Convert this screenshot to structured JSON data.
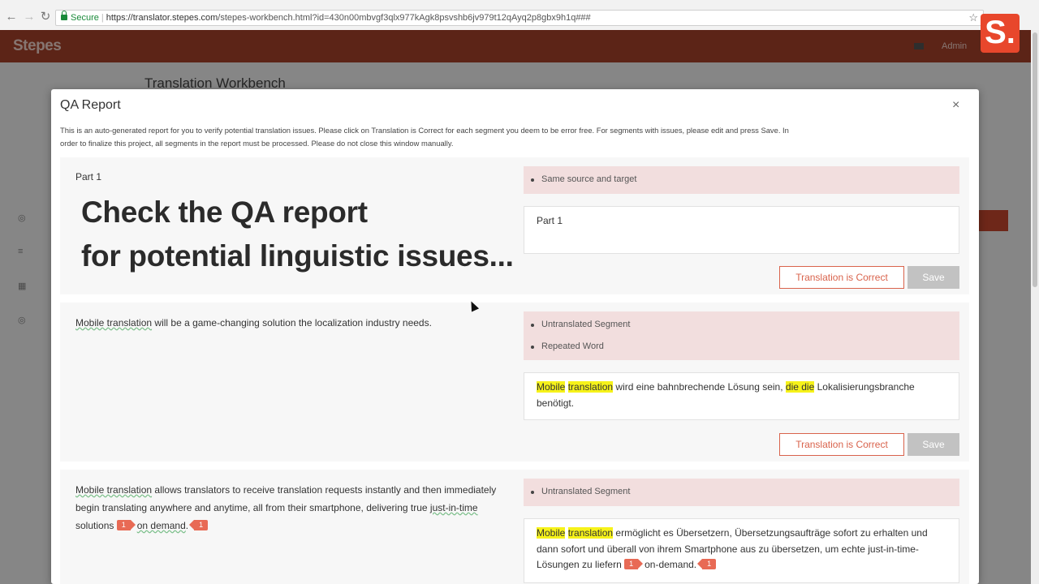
{
  "browser": {
    "secure_label": "Secure",
    "url_host": "https://translator.stepes.com",
    "url_path": "/stepes-workbench.html?id=430n00mbvgf3qlx977kAgk8psvshb6jv979t12qAyq2p8gbx9h1q###"
  },
  "app": {
    "logo": "Stepes",
    "admin_label": "Admin",
    "page_title": "Translation Workbench"
  },
  "brand_badge": "S.",
  "modal": {
    "title": "QA Report",
    "close": "×",
    "description": "This is an auto-generated report for you to verify potential translation issues. Please click on Translation is Correct for each segment you deem to be error free. For segments with issues, please edit and press Save. In order to finalize this project, all segments in the report must be processed. Please do not close this window manually."
  },
  "caption": {
    "line1": "Check the QA report",
    "line2": "for potential linguistic issues..."
  },
  "segments": [
    {
      "source": "Part 1",
      "issues": [
        "Same source and target"
      ],
      "target": "Part 1",
      "correct_label": "Translation is Correct",
      "save_label": "Save"
    },
    {
      "source_term": "Mobile translation",
      "source_rest": " will be a game-changing solution the localization industry needs.",
      "issues": [
        "Untranslated Segment",
        "Repeated Word"
      ],
      "target_hl1": "Mobile",
      "target_hl2": "translation",
      "target_mid": " wird eine bahnbrechende Lösung sein, ",
      "target_hl3": "die die",
      "target_end": " Lokalisierungsbranche benötigt.",
      "correct_label": "Translation is Correct",
      "save_label": "Save"
    },
    {
      "source_term": "Mobile translation",
      "source_rest": " allows translators to receive translation requests instantly and then immediately begin translating anywhere and anytime, all from their smartphone, delivering true ",
      "source_term2": "just-in-time",
      "source_mid": " solutions ",
      "source_tag1": "1",
      "source_term3": "on demand",
      "source_dot": ".",
      "source_tag2": "1",
      "issues": [
        "Untranslated Segment"
      ],
      "target_hl1": "Mobile",
      "target_hl2": "translation",
      "target_rest": " ermöglicht es Übersetzern, Übersetzungsaufträge sofort zu erhalten und dann sofort und überall von ihrem Smartphone aus zu übersetzen, um echte just-in-time-Lösungen zu liefern ",
      "target_tag1": "1",
      "target_term": "on-demand.",
      "target_tag2": "1"
    }
  ]
}
